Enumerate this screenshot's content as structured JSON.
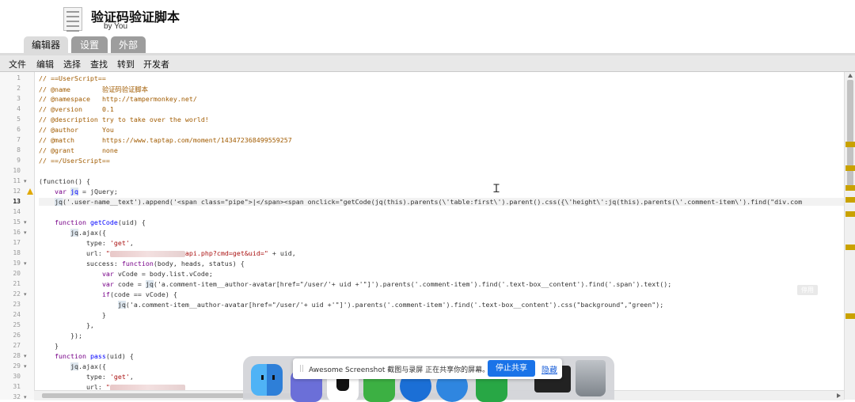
{
  "header": {
    "title": "验证码验证脚本",
    "byline": "by You",
    "icon": "script-file-icon"
  },
  "tabs": [
    {
      "label": "编辑器",
      "active": true
    },
    {
      "label": "设置",
      "active": false
    },
    {
      "label": "外部",
      "active": false
    }
  ],
  "menu": [
    "文件",
    "编辑",
    "选择",
    "查找",
    "转到",
    "开发者"
  ],
  "editor": {
    "current_line": 13,
    "line_numbers": [
      "1",
      "2",
      "3",
      "4",
      "5",
      "6",
      "7",
      "8",
      "9",
      "10",
      "11",
      "12",
      "13",
      "14",
      "15",
      "16",
      "17",
      "18",
      "19",
      "20",
      "21",
      "22",
      "23",
      "24",
      "25",
      "26",
      "27",
      "28",
      "29",
      "30",
      "31",
      "32"
    ],
    "warning_line": 12,
    "folds": [
      "11",
      "15",
      "16",
      "19",
      "22",
      "28",
      "29",
      "32"
    ],
    "code": {
      "l1": "// ==UserScript==",
      "l2a": "// @name        ",
      "l2b": "验证码验证脚本",
      "l3a": "// @namespace   ",
      "l3b": "http://tampermonkey.net/",
      "l4a": "// @version     ",
      "l4b": "0.1",
      "l5a": "// @description ",
      "l5b": "try to take over the world!",
      "l6a": "// @author      ",
      "l6b": "You",
      "l7a": "// @match       ",
      "l7b": "https://www.taptap.com/moment/143472368499559257",
      "l8a": "// @grant       ",
      "l8b": "none",
      "l9": "// ==/UserScript==",
      "l11": "(function() {",
      "l12a": "    var ",
      "l12b": "jq",
      "l12c": " = jQuery;",
      "l13a": "    ",
      "l13b": "jq",
      "l13c": "('.user-name__text').append('<span class=\"pipe\">|</span><span onclick=\"getCode(jq(this).parents(\\'table:first\\').parent().css({\\'height\\':jq(this).parents(\\'.comment-item\\').find(\"div.com",
      "l15a": "    function ",
      "l15b": "getCode",
      "l15c": "(uid) {",
      "l16a": "        ",
      "l16b": "jq",
      "l16c": ".ajax({",
      "l17a": "            type: ",
      "l17b": "'get'",
      "l17c": ",",
      "l18a": "            url: ",
      "l18b": "\"",
      "l18c": "api.php?cmd=get&uid=\"",
      "l18d": " + uid,",
      "l19a": "            success: ",
      "l19b": "function",
      "l19c": "(body, heads, status) {",
      "l20a": "                ",
      "l20b": "var",
      "l20c": " vCode = body.list.vCode;",
      "l21a": "                ",
      "l21b": "var",
      "l21c": " code = ",
      "l21d": "jq",
      "l21e": "('a.comment-item__author-avatar[href=\"/user/'+ uid +'\"]').parents('.comment-item').find('.text-box__content').find('.span').text();",
      "l22a": "                ",
      "l22b": "if",
      "l22c": "(code == vCode) {",
      "l23a": "                    ",
      "l23b": "jq",
      "l23c": "('a.comment-item__author-avatar[href=\"/user/'+ uid +'\"]').parents('.comment-item').find('.text-box__content').css(\"background\",\"green\");",
      "l24": "                }",
      "l25": "            },",
      "l26": "        });",
      "l27": "    }",
      "l28a": "    function ",
      "l28b": "pass",
      "l28c": "(uid) {",
      "l29a": "        ",
      "l29b": "jq",
      "l29c": ".ajax({",
      "l30a": "            type: ",
      "l30b": "'get'",
      "l30c": ",",
      "l31a": "            url: ",
      "l31b": "\""
    }
  },
  "overlay_button": "停用",
  "share_bar": {
    "grip": "||",
    "text": "Awesome Screenshot 截图与录屏 正在共享你的屏幕。",
    "stop_label": "停止共享",
    "hide_label": "隐藏"
  },
  "colors": {
    "accent": "#1a73e8",
    "comment": "#a15b00",
    "keyword": "#770088",
    "definition": "#0000ff",
    "string": "#aa1111",
    "scroll_marker": "#c9a200"
  }
}
